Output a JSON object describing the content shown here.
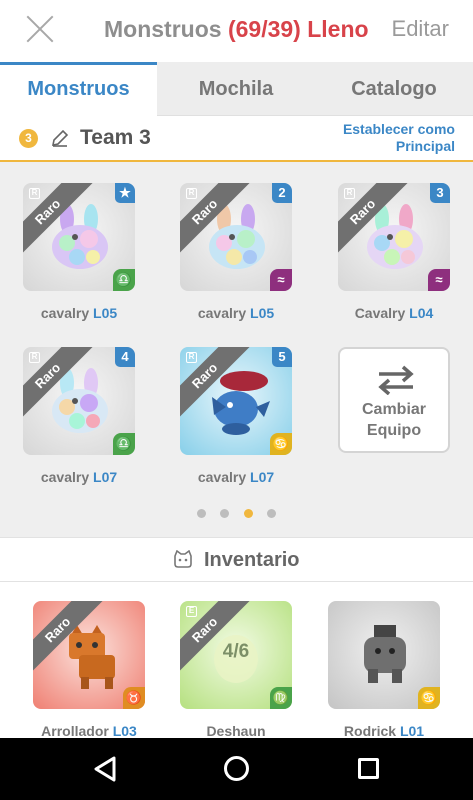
{
  "header": {
    "title_prefix": "Monstruos",
    "count": "(69/39)",
    "full_label": "Lleno",
    "edit_label": "Editar"
  },
  "tabs": [
    {
      "label": "Monstruos",
      "active": true
    },
    {
      "label": "Mochila",
      "active": false
    },
    {
      "label": "Catalogo",
      "active": false
    }
  ],
  "team": {
    "number": "3",
    "name": "Team 3",
    "set_main_line1": "Establecer como",
    "set_main_line2": "Principal"
  },
  "team_slots": [
    {
      "name": "cavalry",
      "level": "L05",
      "rarity": "Raro",
      "badge": "★",
      "element": "♎",
      "element_color": "green",
      "rank": "R"
    },
    {
      "name": "cavalry",
      "level": "L05",
      "rarity": "Raro",
      "badge": "2",
      "element": "≈",
      "element_color": "purple",
      "rank": "R"
    },
    {
      "name": "Cavalry",
      "level": "L04",
      "rarity": "Raro",
      "badge": "3",
      "element": "≈",
      "element_color": "purple",
      "rank": "R"
    },
    {
      "name": "cavalry",
      "level": "L07",
      "rarity": "Raro",
      "badge": "4",
      "element": "♎",
      "element_color": "green",
      "rank": "R"
    },
    {
      "name": "cavalry",
      "level": "L07",
      "rarity": "Raro",
      "badge": "5",
      "element": "♋",
      "element_color": "yellow",
      "rank": "R"
    }
  ],
  "swap": {
    "line1": "Cambiar",
    "line2": "Equipo"
  },
  "pager": {
    "total": 4,
    "active": 2
  },
  "inventory": {
    "title": "Inventario",
    "items": [
      {
        "name": "Arrollador",
        "level": "L03",
        "rarity": "Raro",
        "element": "♉",
        "element_color": "orange"
      },
      {
        "name": "Deshaun",
        "level": "",
        "rarity": "Raro",
        "progress": "4/6",
        "element": "♍",
        "element_color": "green",
        "rank": "E"
      },
      {
        "name": "Rodrick",
        "level": "L01",
        "rarity": "",
        "element": "♋",
        "element_color": "yellow"
      }
    ]
  },
  "colors": {
    "accent_blue": "#3b87c6",
    "full_red": "#d8434a",
    "team_yellow": "#f0b73e"
  }
}
